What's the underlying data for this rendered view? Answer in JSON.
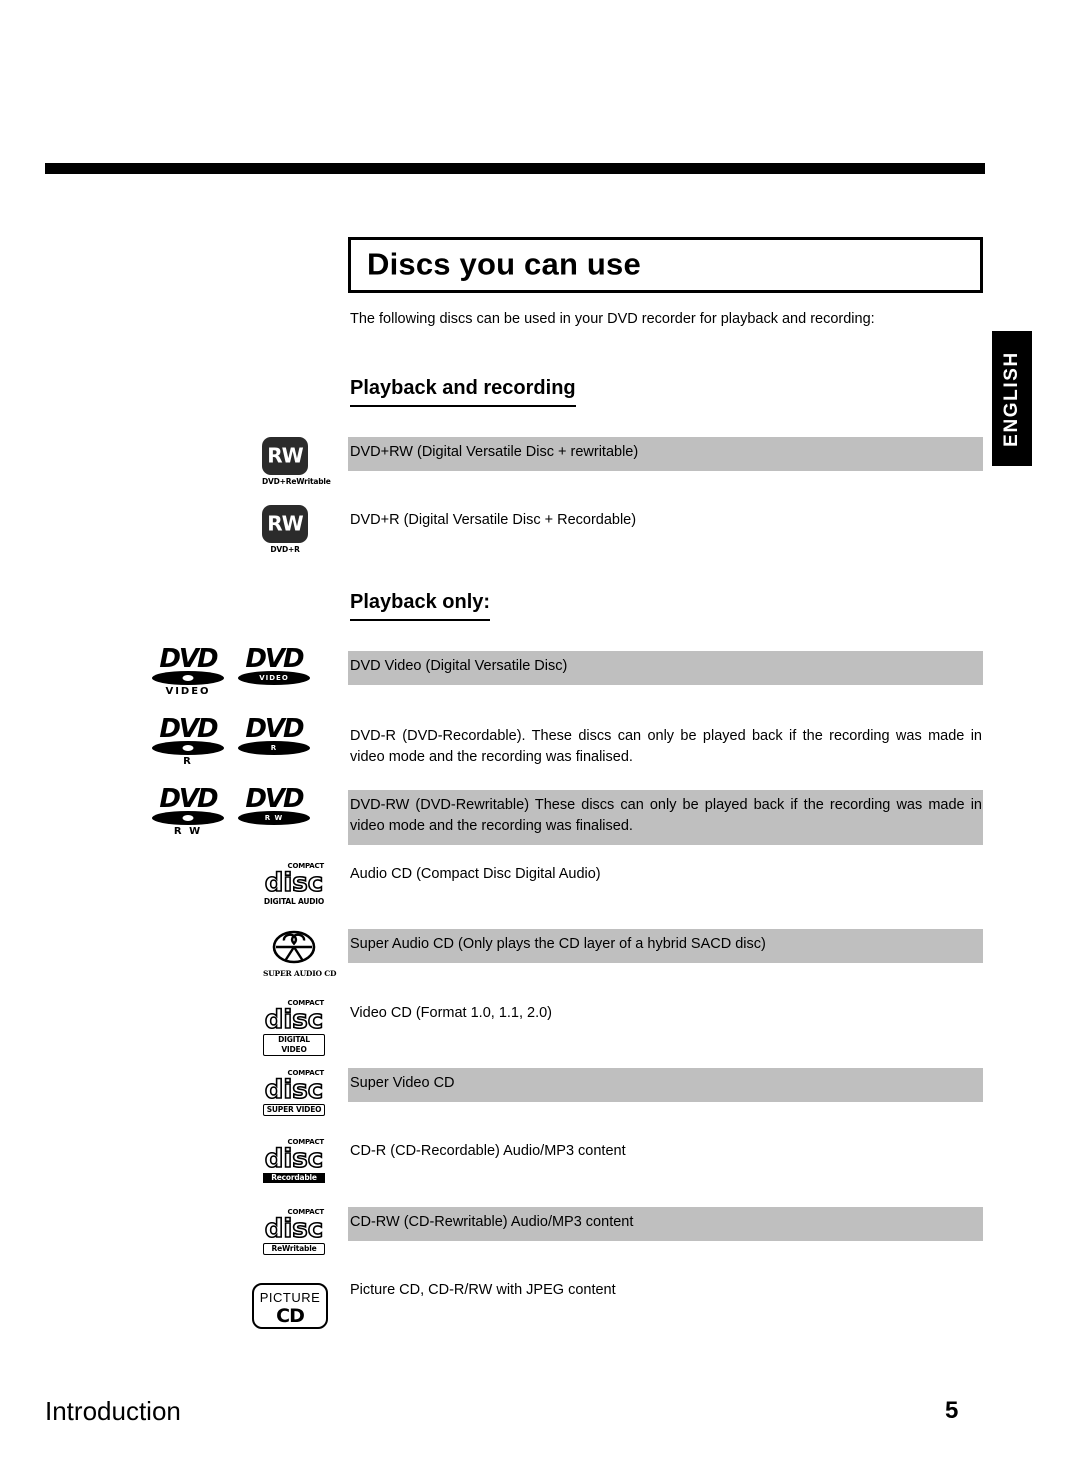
{
  "document": {
    "language_tab": "ENGLISH",
    "title": "Discs you can use",
    "intro": "The following discs can be used in your DVD recorder for playback and recording:",
    "footer_section": "Introduction",
    "page_number": "5"
  },
  "sections": {
    "playback_recording": "Playback and recording",
    "playback_only": "Playback only:"
  },
  "colors": {
    "band_gray": "#bfbfbf",
    "rule_black": "#000000",
    "logo_dark": "#2b2b2b"
  },
  "rows": [
    {
      "id": "dvd-plus-rw",
      "text": "DVD+RW (Digital Versatile Disc + rewritable)",
      "highlighted": true,
      "logo": {
        "kind": "rw-block",
        "mark": "RW",
        "caption": "DVD+ReWritable"
      }
    },
    {
      "id": "dvd-plus-r",
      "text": "DVD+R (Digital Versatile Disc + Recordable)",
      "highlighted": false,
      "logo": {
        "kind": "rw-block",
        "mark": "RW",
        "caption": "DVD+R"
      }
    },
    {
      "id": "dvd-video",
      "text": "DVD Video (Digital Versatile Disc)",
      "highlighted": true,
      "logo": {
        "kind": "dvd-pair",
        "word": "DVD",
        "sub": "VIDEO",
        "inner": "VIDEO"
      }
    },
    {
      "id": "dvd-r",
      "text": "DVD-R (DVD-Recordable). These discs can only be played back if the recording was made in video mode and the recording was finalised.",
      "highlighted": false,
      "logo": {
        "kind": "dvd-pair",
        "word": "DVD",
        "sub": "R",
        "inner": "R"
      }
    },
    {
      "id": "dvd-rw",
      "text": "DVD-RW (DVD-Rewritable) These discs can only be played back if the recording was made in video mode and the recording was finalised.",
      "highlighted": true,
      "logo": {
        "kind": "dvd-pair",
        "word": "DVD",
        "sub": "R W",
        "inner": "R W"
      }
    },
    {
      "id": "audio-cd",
      "text": "Audio CD (Compact Disc Digital Audio)",
      "highlighted": false,
      "logo": {
        "kind": "compact-disc",
        "top": "COMPACT",
        "word": "disc",
        "bottom": "DIGITAL AUDIO",
        "bottom_style": "plain"
      }
    },
    {
      "id": "super-audio-cd",
      "text": "Super Audio CD (Only plays the CD layer of a hybrid SACD disc)",
      "highlighted": true,
      "logo": {
        "kind": "sacd",
        "caption": "SUPER AUDIO CD"
      }
    },
    {
      "id": "video-cd",
      "text": "Video CD (Format 1.0, 1.1, 2.0)",
      "highlighted": false,
      "logo": {
        "kind": "compact-disc",
        "top": "COMPACT",
        "word": "disc",
        "bottom": "DIGITAL VIDEO",
        "bottom_style": "boxed"
      }
    },
    {
      "id": "super-video-cd",
      "text": "Super Video CD",
      "highlighted": true,
      "logo": {
        "kind": "compact-disc",
        "top": "COMPACT",
        "word": "disc",
        "bottom": "SUPER VIDEO",
        "bottom_style": "boxed"
      }
    },
    {
      "id": "cd-r",
      "text": "CD-R (CD-Recordable) Audio/MP3 content",
      "highlighted": false,
      "logo": {
        "kind": "compact-disc",
        "top": "COMPACT",
        "word": "disc",
        "bottom": "Recordable",
        "bottom_style": "inv"
      }
    },
    {
      "id": "cd-rw",
      "text": "CD-RW (CD-Rewritable) Audio/MP3 content",
      "highlighted": true,
      "logo": {
        "kind": "compact-disc",
        "top": "COMPACT",
        "word": "disc",
        "bottom": "ReWritable",
        "bottom_style": "boxed"
      }
    },
    {
      "id": "picture-cd",
      "text": "Picture CD, CD-R/RW with JPEG content",
      "highlighted": false,
      "logo": {
        "kind": "picture-cd",
        "line1": "PICTURE",
        "line2": "CD"
      }
    }
  ]
}
